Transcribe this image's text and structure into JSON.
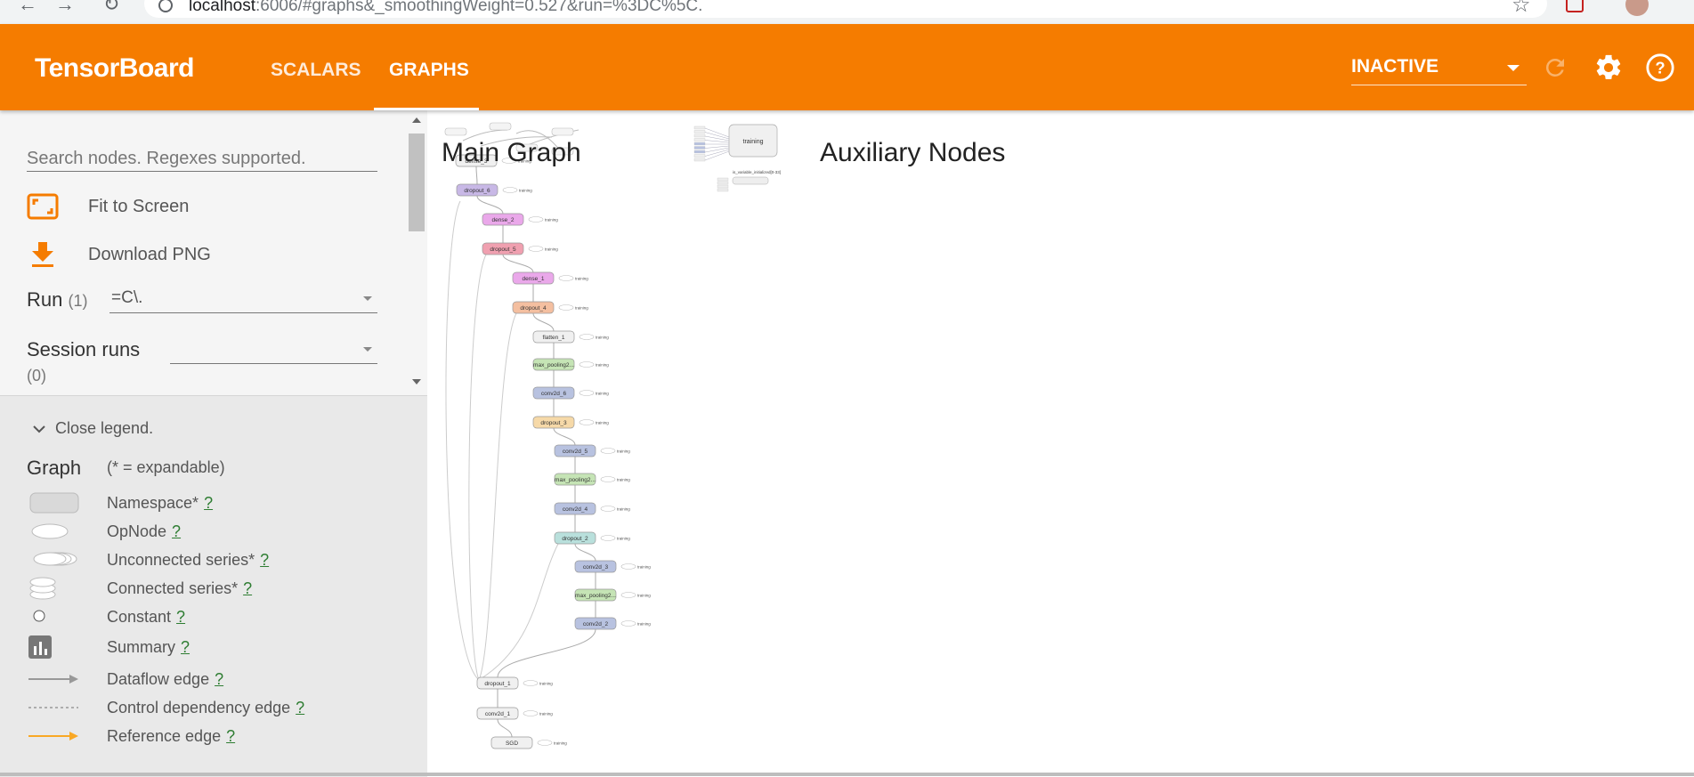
{
  "browser": {
    "url_host": "localhost",
    "url_rest": ":6006/#graphs&_smoothingWeight=0.527&run=%3DC%5C.",
    "back_icon": "back-arrow-icon",
    "forward_icon": "forward-arrow-icon",
    "reload_icon": "reload-icon",
    "star_icon": "star-icon"
  },
  "header": {
    "brand": "TensorBoard",
    "tabs": [
      {
        "label": "SCALARS",
        "active": false
      },
      {
        "label": "GRAPHS",
        "active": true
      }
    ],
    "status": "INACTIVE",
    "colors": {
      "header_bg": "#f57c00",
      "text": "#ffffff"
    }
  },
  "sidebar": {
    "search_placeholder": "Search nodes. Regexes supported.",
    "fit_label": "Fit to Screen",
    "download_label": "Download PNG",
    "run_label": "Run",
    "run_count": "(1)",
    "run_value": "=C\\.",
    "session_label": "Session runs",
    "session_count": "(0)",
    "icon_color": "#f57c00"
  },
  "legend": {
    "close_label": "Close legend.",
    "title": "Graph",
    "expandable_note": "(* = expandable)",
    "help_mark": "?",
    "items": [
      {
        "label": "Namespace*"
      },
      {
        "label": "OpNode"
      },
      {
        "label": "Unconnected series*"
      },
      {
        "label": "Connected series*"
      },
      {
        "label": "Constant"
      },
      {
        "label": "Summary"
      },
      {
        "label": "Dataflow edge"
      },
      {
        "label": "Control dependency edge"
      },
      {
        "label": "Reference edge"
      }
    ]
  },
  "graph": {
    "main_title": "Main Graph",
    "aux_title": "Auxiliary Nodes",
    "nodes": [
      {
        "label": "dense_3",
        "kind": "namespace",
        "color": "#f0f0f0"
      },
      {
        "label": "dropout_6",
        "kind": "namespace",
        "color": "#c8b8e6"
      },
      {
        "label": "dense_2",
        "kind": "namespace",
        "color": "#eaa8ea"
      },
      {
        "label": "dropout_5",
        "kind": "namespace",
        "color": "#f0a0b0"
      },
      {
        "label": "dense_1",
        "kind": "namespace",
        "color": "#eaa8ea"
      },
      {
        "label": "dropout_4",
        "kind": "namespace",
        "color": "#f4bfa0"
      },
      {
        "label": "flatten_1",
        "kind": "namespace",
        "color": "#f0f0f0"
      },
      {
        "label": "max_pooling2...",
        "kind": "namespace",
        "color": "#c5e4b5"
      },
      {
        "label": "conv2d_6",
        "kind": "namespace",
        "color": "#b8c2e0"
      },
      {
        "label": "dropout_3",
        "kind": "namespace",
        "color": "#f6d9a8"
      },
      {
        "label": "conv2d_5",
        "kind": "namespace",
        "color": "#b8c2e0"
      },
      {
        "label": "max_pooling2...",
        "kind": "namespace",
        "color": "#c5e4b5"
      },
      {
        "label": "conv2d_4",
        "kind": "namespace",
        "color": "#b8c2e0"
      },
      {
        "label": "dropout_2",
        "kind": "namespace",
        "color": "#b9e0dc"
      },
      {
        "label": "conv2d_3",
        "kind": "namespace",
        "color": "#b8c2e0"
      },
      {
        "label": "max_pooling2...",
        "kind": "namespace",
        "color": "#c5e4b5"
      },
      {
        "label": "conv2d_2",
        "kind": "namespace",
        "color": "#b8c2e0"
      },
      {
        "label": "dropout_1",
        "kind": "namespace",
        "color": "#f0f0f0"
      },
      {
        "label": "conv2d_1",
        "kind": "namespace",
        "color": "#f0f0f0"
      },
      {
        "label": "SGD",
        "kind": "namespace",
        "color": "#f0f0f0"
      }
    ],
    "side_label": "training",
    "aux_node_label": "training",
    "aux_init_label": "is_variable_initialized[0-33]"
  }
}
